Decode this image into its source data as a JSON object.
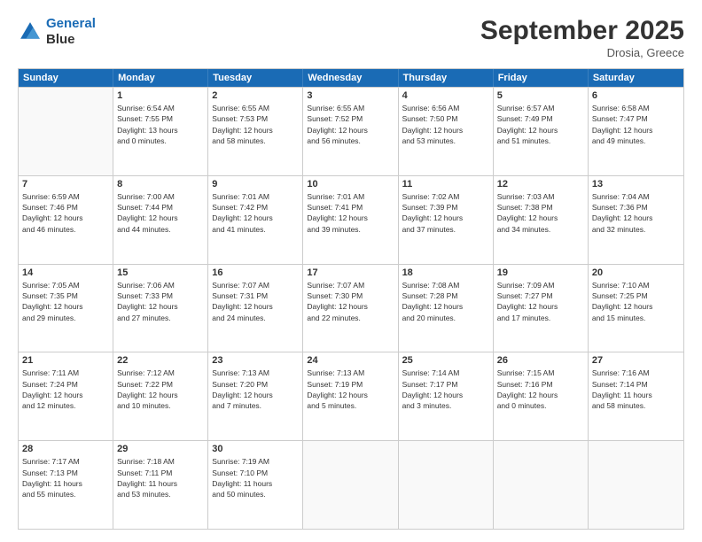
{
  "header": {
    "logo_line1": "General",
    "logo_line2": "Blue",
    "month": "September 2025",
    "location": "Drosia, Greece"
  },
  "weekdays": [
    "Sunday",
    "Monday",
    "Tuesday",
    "Wednesday",
    "Thursday",
    "Friday",
    "Saturday"
  ],
  "rows": [
    [
      {
        "day": "",
        "detail": ""
      },
      {
        "day": "1",
        "detail": "Sunrise: 6:54 AM\nSunset: 7:55 PM\nDaylight: 13 hours\nand 0 minutes."
      },
      {
        "day": "2",
        "detail": "Sunrise: 6:55 AM\nSunset: 7:53 PM\nDaylight: 12 hours\nand 58 minutes."
      },
      {
        "day": "3",
        "detail": "Sunrise: 6:55 AM\nSunset: 7:52 PM\nDaylight: 12 hours\nand 56 minutes."
      },
      {
        "day": "4",
        "detail": "Sunrise: 6:56 AM\nSunset: 7:50 PM\nDaylight: 12 hours\nand 53 minutes."
      },
      {
        "day": "5",
        "detail": "Sunrise: 6:57 AM\nSunset: 7:49 PM\nDaylight: 12 hours\nand 51 minutes."
      },
      {
        "day": "6",
        "detail": "Sunrise: 6:58 AM\nSunset: 7:47 PM\nDaylight: 12 hours\nand 49 minutes."
      }
    ],
    [
      {
        "day": "7",
        "detail": "Sunrise: 6:59 AM\nSunset: 7:46 PM\nDaylight: 12 hours\nand 46 minutes."
      },
      {
        "day": "8",
        "detail": "Sunrise: 7:00 AM\nSunset: 7:44 PM\nDaylight: 12 hours\nand 44 minutes."
      },
      {
        "day": "9",
        "detail": "Sunrise: 7:01 AM\nSunset: 7:42 PM\nDaylight: 12 hours\nand 41 minutes."
      },
      {
        "day": "10",
        "detail": "Sunrise: 7:01 AM\nSunset: 7:41 PM\nDaylight: 12 hours\nand 39 minutes."
      },
      {
        "day": "11",
        "detail": "Sunrise: 7:02 AM\nSunset: 7:39 PM\nDaylight: 12 hours\nand 37 minutes."
      },
      {
        "day": "12",
        "detail": "Sunrise: 7:03 AM\nSunset: 7:38 PM\nDaylight: 12 hours\nand 34 minutes."
      },
      {
        "day": "13",
        "detail": "Sunrise: 7:04 AM\nSunset: 7:36 PM\nDaylight: 12 hours\nand 32 minutes."
      }
    ],
    [
      {
        "day": "14",
        "detail": "Sunrise: 7:05 AM\nSunset: 7:35 PM\nDaylight: 12 hours\nand 29 minutes."
      },
      {
        "day": "15",
        "detail": "Sunrise: 7:06 AM\nSunset: 7:33 PM\nDaylight: 12 hours\nand 27 minutes."
      },
      {
        "day": "16",
        "detail": "Sunrise: 7:07 AM\nSunset: 7:31 PM\nDaylight: 12 hours\nand 24 minutes."
      },
      {
        "day": "17",
        "detail": "Sunrise: 7:07 AM\nSunset: 7:30 PM\nDaylight: 12 hours\nand 22 minutes."
      },
      {
        "day": "18",
        "detail": "Sunrise: 7:08 AM\nSunset: 7:28 PM\nDaylight: 12 hours\nand 20 minutes."
      },
      {
        "day": "19",
        "detail": "Sunrise: 7:09 AM\nSunset: 7:27 PM\nDaylight: 12 hours\nand 17 minutes."
      },
      {
        "day": "20",
        "detail": "Sunrise: 7:10 AM\nSunset: 7:25 PM\nDaylight: 12 hours\nand 15 minutes."
      }
    ],
    [
      {
        "day": "21",
        "detail": "Sunrise: 7:11 AM\nSunset: 7:24 PM\nDaylight: 12 hours\nand 12 minutes."
      },
      {
        "day": "22",
        "detail": "Sunrise: 7:12 AM\nSunset: 7:22 PM\nDaylight: 12 hours\nand 10 minutes."
      },
      {
        "day": "23",
        "detail": "Sunrise: 7:13 AM\nSunset: 7:20 PM\nDaylight: 12 hours\nand 7 minutes."
      },
      {
        "day": "24",
        "detail": "Sunrise: 7:13 AM\nSunset: 7:19 PM\nDaylight: 12 hours\nand 5 minutes."
      },
      {
        "day": "25",
        "detail": "Sunrise: 7:14 AM\nSunset: 7:17 PM\nDaylight: 12 hours\nand 3 minutes."
      },
      {
        "day": "26",
        "detail": "Sunrise: 7:15 AM\nSunset: 7:16 PM\nDaylight: 12 hours\nand 0 minutes."
      },
      {
        "day": "27",
        "detail": "Sunrise: 7:16 AM\nSunset: 7:14 PM\nDaylight: 11 hours\nand 58 minutes."
      }
    ],
    [
      {
        "day": "28",
        "detail": "Sunrise: 7:17 AM\nSunset: 7:13 PM\nDaylight: 11 hours\nand 55 minutes."
      },
      {
        "day": "29",
        "detail": "Sunrise: 7:18 AM\nSunset: 7:11 PM\nDaylight: 11 hours\nand 53 minutes."
      },
      {
        "day": "30",
        "detail": "Sunrise: 7:19 AM\nSunset: 7:10 PM\nDaylight: 11 hours\nand 50 minutes."
      },
      {
        "day": "",
        "detail": ""
      },
      {
        "day": "",
        "detail": ""
      },
      {
        "day": "",
        "detail": ""
      },
      {
        "day": "",
        "detail": ""
      }
    ]
  ]
}
